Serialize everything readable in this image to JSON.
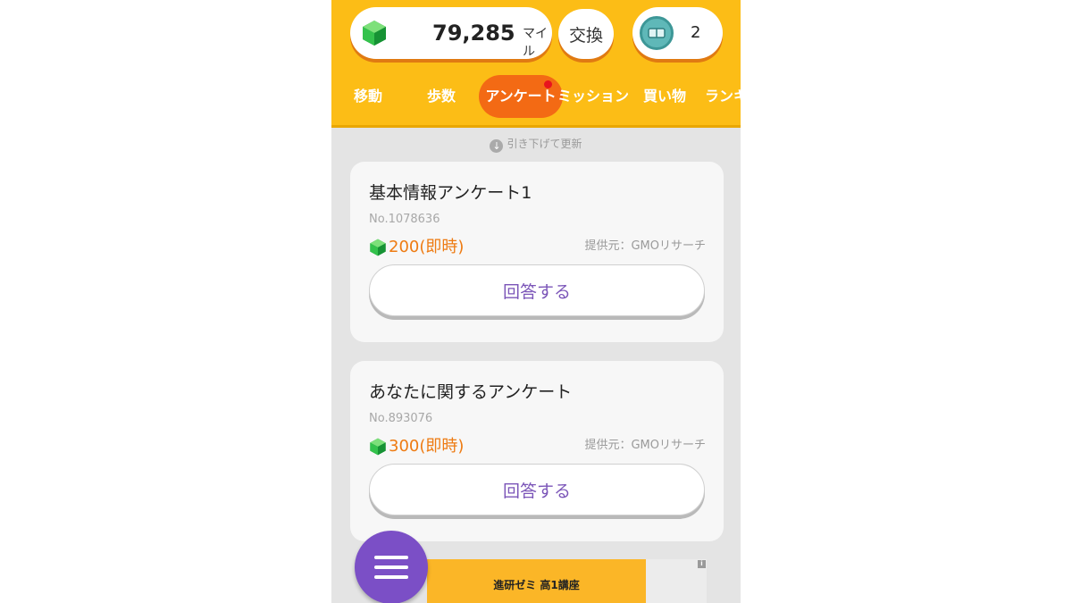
{
  "header": {
    "miles": {
      "value": "79,285",
      "unit": "マイル",
      "icon": "green-gem-icon"
    },
    "exchange_label": "交換",
    "tickets": {
      "count": "2",
      "icon": "ticket-coin-icon"
    }
  },
  "tabs": [
    {
      "label": "移動"
    },
    {
      "label": "歩数"
    },
    {
      "label": "アンケート",
      "active": true,
      "has_notification": true
    },
    {
      "label": "ミッション"
    },
    {
      "label": "買い物"
    },
    {
      "label": "ランキ"
    }
  ],
  "refresh_hint": "引き下げて更新",
  "surveys": [
    {
      "title": "基本情報アンケート1",
      "number": "No.1078636",
      "reward": "200(即時)",
      "provider": "提供元：GMOリサーチ",
      "button_label": "回答する"
    },
    {
      "title": "あなたに関するアンケート",
      "number": "No.893076",
      "reward": "300(即時)",
      "provider": "提供元：GMOリサーチ",
      "button_label": "回答する"
    }
  ],
  "ad": {
    "text": "進研ゼミ 高1講座",
    "info": "i"
  },
  "colors": {
    "header": "#fcbd16",
    "active_tab": "#f36a14",
    "reward": "#ee7b12",
    "button_text": "#7b55b8",
    "fab": "#7b4fc6"
  }
}
